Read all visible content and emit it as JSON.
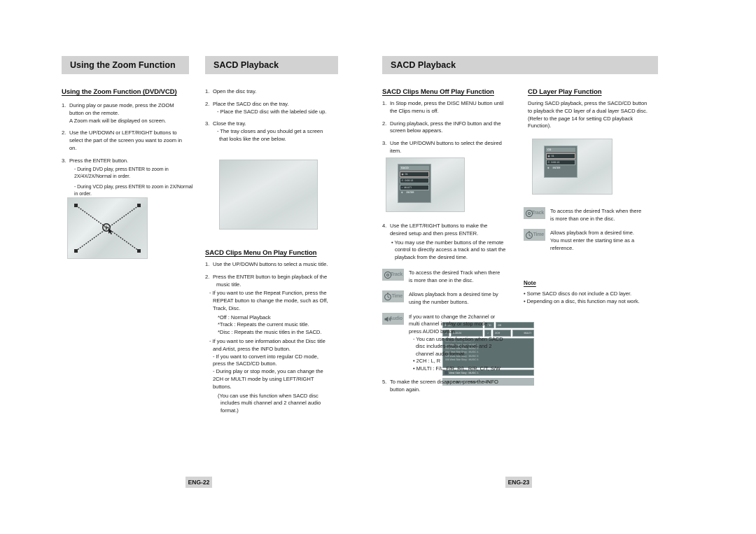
{
  "banners": {
    "left": "Using the Zoom Function",
    "middle": "SACD Playback",
    "right": "SACD Playback"
  },
  "col_a": {
    "heading": "Using the Zoom Function (DVD/VCD)",
    "steps": [
      {
        "n": "1.",
        "lines": [
          "During play or pause mode, press the ZOOM",
          "button on the remote.",
          "A Zoom mark will be displayed on screen."
        ]
      },
      {
        "n": "2.",
        "lines": [
          "Use the UP/DOWN or LEFT/RIGHT buttons to",
          "select the part of the screen you want to zoom in",
          "on."
        ]
      },
      {
        "n": "3.",
        "lines": [
          "Press the ENTER button."
        ]
      }
    ],
    "sub_bullets": [
      "- During DVD play, press ENTER to zoom in",
      "2X/4X/2X/Normal in order.",
      "- During VCD play, press ENTER to zoom in 2X/Normal",
      "in order."
    ],
    "figure_name": "zoom-crosshair-diagram"
  },
  "col_b": {
    "steps": [
      {
        "n": "1.",
        "lines": [
          "Open the disc tray."
        ]
      },
      {
        "n": "2.",
        "lines": [
          "Place the SACD disc on the tray."
        ],
        "sub": [
          "- Place the SACD disc with the labeled side up."
        ]
      },
      {
        "n": "3.",
        "lines": [
          "Close the tray."
        ],
        "sub": [
          "- The tray closes and you should get a screen",
          "that looks like the one below."
        ]
      }
    ],
    "screen": {
      "title": "SACD",
      "cd_tag": "CD",
      "cd_value": "Off",
      "time": "0:00:24",
      "mode_left": "2CH",
      "mode_right": "MULTI",
      "list_header": "West Side Story : MUSIC 1",
      "tracks": [
        "002 West Side Story : MUSIC 2",
        "003 West Side Story : MUSIC 3",
        "004 West Side Story : MUSIC 4",
        "005 West Side Story : MUSIC 5",
        "006 West Side Story : MUSIC 6"
      ],
      "now_playing": "West Side Story : MUSIC 1",
      "footer": [
        "ENTER",
        "GROUP",
        "AUTO"
      ]
    },
    "heading2": "SACD Clips Menu On Play Function",
    "steps2": [
      {
        "n": "1.",
        "lines": [
          "Use the UP/DOWN buttons to select a music title."
        ]
      },
      {
        "n": "2.",
        "lines": [
          "Press the ENTER button to begin playback of the",
          "music title."
        ]
      }
    ],
    "bullets2": [
      "- If you want to use the Repeat Function, press the",
      "REPEAT button to change the mode, such as Off,",
      "Track, Disc."
    ],
    "stars2": [
      "*Off : Normal Playback",
      "*Track : Repeats the current music title.",
      "*Disc : Repeats the music titles in the SACD."
    ],
    "bullets3": [
      "- If you want to see information about the Disc title",
      "and Artist, press the INFO button.",
      "- If you want to convert into regular CD mode,",
      "press the SACD/CD button.",
      "- During play or stop mode, you can change the",
      "2CH or MULTI mode by using LEFT/RIGHT",
      "buttons."
    ],
    "paren": [
      "(You can use this function when SACD disc",
      "includes multi channel and 2 channel audio",
      "format.)"
    ]
  },
  "col_c": {
    "heading": "SACD Clips Menu Off Play Function",
    "steps": [
      {
        "n": "1.",
        "lines": [
          "In Stop mode, press the DISC MENU button until",
          "the Clips menu is off."
        ]
      },
      {
        "n": "2.",
        "lines": [
          "During playback, press the INFO button and the",
          "screen below appears."
        ]
      },
      {
        "n": "3.",
        "lines": [
          "Use the UP/DOWN buttons to select the desired",
          "item."
        ]
      }
    ],
    "screen": {
      "title": "SACD",
      "track": "01",
      "time": "0:00:13",
      "mode": "MULTI",
      "footer": "ENTER"
    },
    "step4": {
      "n": "4.",
      "lines": [
        "Use the LEFT/RIGHT buttons to make the",
        "desired setup and then press ENTER."
      ]
    },
    "step4_bullet": [
      "• You may use the number buttons of the remote",
      "control to directly access a track and to start the",
      "playback from the desired time."
    ],
    "badges": [
      {
        "icon": "track-icon",
        "label": "Track",
        "text": [
          "To access the desired Track when there",
          "is more than one in the disc."
        ]
      },
      {
        "icon": "time-icon",
        "label": "Time",
        "text": [
          "Allows playback from a desired time by",
          "using the number buttons."
        ]
      },
      {
        "icon": "audio-icon",
        "label": "Audio",
        "text": [
          "If you want to change the 2channel or",
          "multi channel in play or stop mode,",
          "press AUDIO button."
        ],
        "sub": [
          "- You can use this function when SACD",
          "disc includes multi channel and 2",
          "channel audio format."
        ],
        "dots": [
          "• 2CH : L, R",
          "• MULTI : F/L, F/R, R/L, R/R, C/T, S/W"
        ]
      }
    ],
    "step5": {
      "n": "5.",
      "lines": [
        "To make the screen disappear, press the INFO",
        "button again."
      ]
    }
  },
  "col_d": {
    "heading": "CD Layer Play Function",
    "body": [
      "During SACD playback, press the SACD/CD button",
      "to playback the CD layer of a dual layer SACD disc.",
      "(Refer to the page 14 for setting CD playback",
      "Function)."
    ],
    "screen": {
      "title": "CD",
      "track": "01",
      "time": "0:00:13",
      "footer": "ENTER"
    },
    "badges": [
      {
        "icon": "track-icon",
        "label": "Track",
        "text": [
          "To access the desired Track when there",
          "is more than one in the disc."
        ]
      },
      {
        "icon": "time-icon",
        "label": "Time",
        "text": [
          "Allows playback from a desired time.",
          "You must enter the starting time as a",
          "reference."
        ]
      }
    ],
    "note_heading": "Note",
    "notes": [
      "• Some SACD discs do not include a CD layer.",
      "• Depending on a disc, this function may not work."
    ]
  },
  "footers": {
    "left_page": "ENG-22",
    "right_page": "ENG-23"
  },
  "colors": {
    "banner_bg": "#d2d2d2",
    "badge_bg": "#b7bfbf",
    "osd_bg": "#5e6f70",
    "page_tag_bg": "#d3d3d3"
  }
}
